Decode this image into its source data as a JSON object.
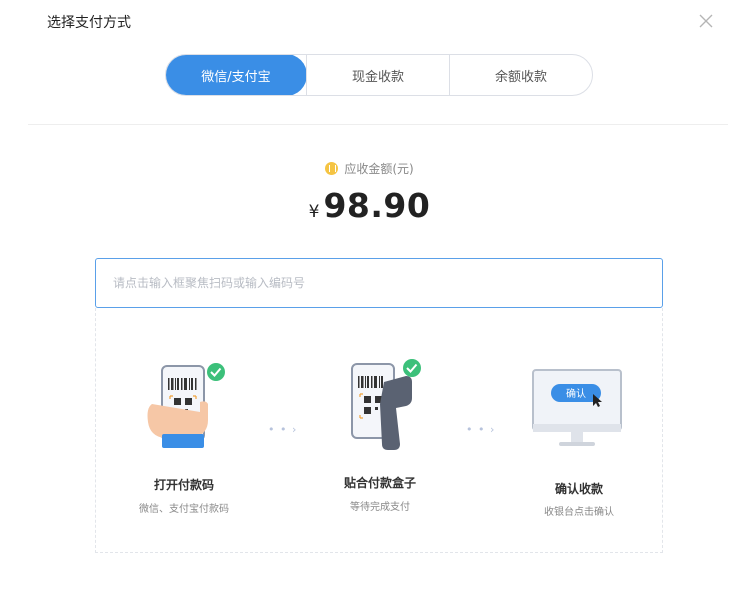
{
  "dialog": {
    "title": "选择支付方式"
  },
  "tabs": [
    {
      "label": "微信/支付宝",
      "active": true
    },
    {
      "label": "现金收款",
      "active": false
    },
    {
      "label": "余额收款",
      "active": false
    }
  ],
  "amount": {
    "label": "应收金额(元)",
    "currency": "¥",
    "value": "98.90"
  },
  "scan_input": {
    "placeholder": "请点击输入框聚焦扫码或输入编码号",
    "value": ""
  },
  "steps": [
    {
      "title": "打开付款码",
      "desc": "微信、支付宝付款码"
    },
    {
      "title": "贴合付款盒子",
      "desc": "等待完成支付"
    },
    {
      "title": "确认收款",
      "desc": "收银台点击确认",
      "button_label": "确认"
    }
  ],
  "colors": {
    "accent": "#3a8ee6",
    "success": "#3cc07a",
    "coin": "#f5c443"
  }
}
